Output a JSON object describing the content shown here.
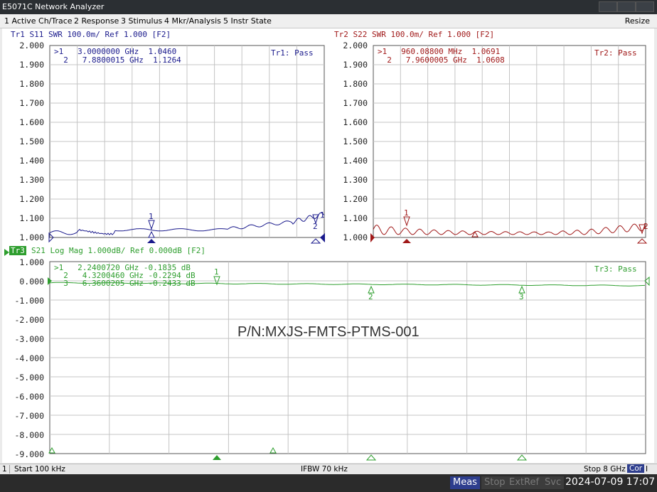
{
  "window": {
    "title": "E5071C Network Analyzer"
  },
  "menu": {
    "items": [
      "1 Active Ch/Trace",
      "2 Response",
      "3 Stimulus",
      "4 Mkr/Analysis",
      "5 Instr State"
    ],
    "resize": "Resize"
  },
  "tr1": {
    "title": "Tr1  S11  SWR 100.0m/  Ref 1.000  [F2]",
    "color": "#1a1a8c",
    "pass": "Tr1: Pass",
    "y_ticks": [
      "2.000",
      "1.900",
      "1.800",
      "1.700",
      "1.600",
      "1.500",
      "1.400",
      "1.300",
      "1.200",
      "1.100",
      "1.000"
    ],
    "markers": [
      ">1   3.0000000 GHz  1.0460",
      "  2   7.8800015 GHz  1.1264"
    ],
    "marker_labels": [
      "1",
      "2"
    ]
  },
  "tr2": {
    "title": "Tr2  S22  SWR 100.0m/  Ref 1.000  [F2]",
    "color": "#a01818",
    "pass": "Tr2: Pass",
    "y_ticks": [
      "2.000",
      "1.900",
      "1.800",
      "1.700",
      "1.600",
      "1.500",
      "1.400",
      "1.300",
      "1.200",
      "1.100",
      "1.000"
    ],
    "markers": [
      ">1   960.08800 MHz  1.0691",
      "  2   7.9600005 GHz  1.0608"
    ],
    "marker_labels": [
      "1",
      "2"
    ]
  },
  "tr3": {
    "label": "Tr3",
    "title": "S21  Log Mag 1.000dB/  Ref 0.000dB  [F2]",
    "color": "#2e9e2e",
    "pass": "Tr3: Pass",
    "y_ticks": [
      "1.000",
      "0.000",
      "-1.000",
      "-2.000",
      "-3.000",
      "-4.000",
      "-5.000",
      "-6.000",
      "-7.000",
      "-8.000",
      "-9.000"
    ],
    "markers": [
      ">1   2.2400720 GHz -0.1835 dB",
      "  2   4.3200460 GHz -0.2294 dB",
      "  3   6.3600205 GHz -0.2433 dB"
    ],
    "marker_labels": [
      "1",
      "2",
      "3"
    ],
    "annotation": "P/N:MXJS-FMTS-PTMS-001"
  },
  "status": {
    "channel": "1",
    "start": "Start 100 kHz",
    "ifbw": "IFBW 70 kHz",
    "stop": "Stop 8 GHz",
    "cor": "Cor",
    "indicator": "I"
  },
  "bottom": {
    "buttons": [
      "Meas",
      "Stop",
      "ExtRef",
      "Svc"
    ],
    "datetime": "2024-07-09 17:07"
  }
}
